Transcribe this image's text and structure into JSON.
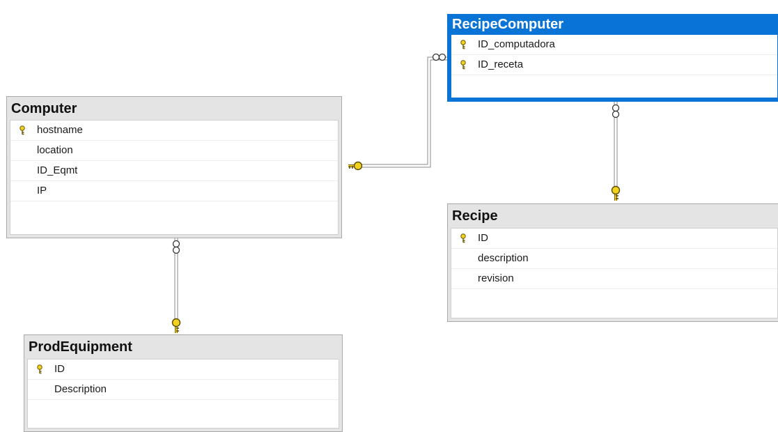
{
  "tables": [
    {
      "name": "RecipeComputer",
      "selected": true,
      "columns": [
        {
          "name": "ID_computadora",
          "key": true
        },
        {
          "name": "ID_receta",
          "key": true
        }
      ]
    },
    {
      "name": "Computer",
      "selected": false,
      "columns": [
        {
          "name": "hostname",
          "key": true
        },
        {
          "name": "location",
          "key": false
        },
        {
          "name": "ID_Eqmt",
          "key": false
        },
        {
          "name": "IP",
          "key": false
        }
      ]
    },
    {
      "name": "Recipe",
      "selected": false,
      "columns": [
        {
          "name": "ID",
          "key": true
        },
        {
          "name": "description",
          "key": false
        },
        {
          "name": "revision",
          "key": false
        }
      ]
    },
    {
      "name": "ProdEquipment",
      "selected": false,
      "columns": [
        {
          "name": "ID",
          "key": true
        },
        {
          "name": "Description",
          "key": false
        }
      ]
    }
  ],
  "relationships": [
    {
      "from": "RecipeComputer",
      "to": "Computer",
      "many_end": "RecipeComputer",
      "one_end": "Computer"
    },
    {
      "from": "RecipeComputer",
      "to": "Recipe",
      "many_end": "RecipeComputer",
      "one_end": "Recipe"
    },
    {
      "from": "Computer",
      "to": "ProdEquipment",
      "many_end": "Computer",
      "one_end": "ProdEquipment"
    }
  ],
  "colors": {
    "selected_border": "#0a74d6",
    "key_icon": "#f2d21f",
    "line": "#8a8a8a"
  }
}
